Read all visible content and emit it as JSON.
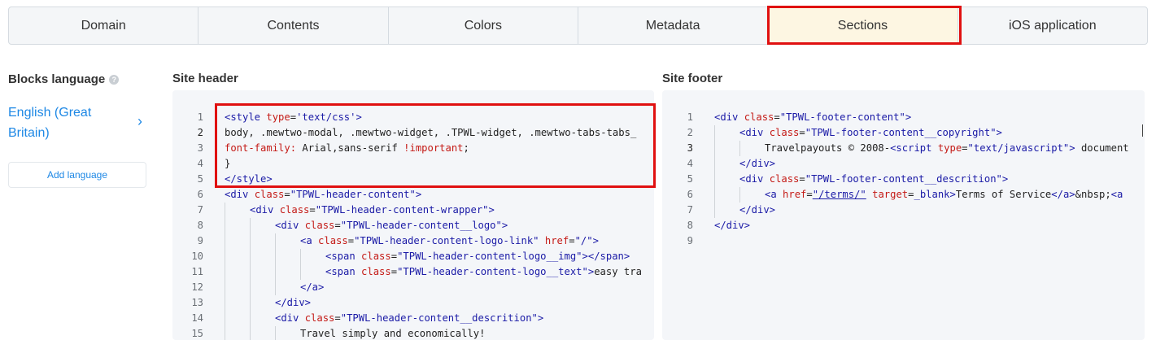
{
  "tabs": [
    {
      "label": "Domain"
    },
    {
      "label": "Contents"
    },
    {
      "label": "Colors"
    },
    {
      "label": "Metadata"
    },
    {
      "label": "Sections",
      "active": true
    },
    {
      "label": "iOS application"
    }
  ],
  "left": {
    "blocks_language_label": "Blocks language",
    "help_glyph": "?",
    "language": "English (Great Britain)",
    "add_language": "Add language"
  },
  "header_section": {
    "title": "Site header",
    "lines": [
      "<style type='text/css'>",
      "body, .mewtwo-modal, .mewtwo-widget, .TPWL-widget, .mewtwo-tabs-tabs_",
      "font-family: Arial,sans-serif !important;",
      "}",
      "</style>",
      "<div class=\"TPWL-header-content\">",
      "    <div class=\"TPWL-header-content-wrapper\">",
      "        <div class=\"TPWL-header-content__logo\">",
      "            <a class=\"TPWL-header-content-logo-link\" href=\"/\">",
      "                <span class=\"TPWL-header-content-logo__img\"></span>",
      "                <span class=\"TPWL-header-content-logo__text\">easy tra",
      "            </a>",
      "        </div>",
      "        <div class=\"TPWL-header-content__descrition\">",
      "            Travel simply and economically!"
    ]
  },
  "footer_section": {
    "title": "Site footer",
    "lines": [
      "<div class=\"TPWL-footer-content\">",
      "    <div class=\"TPWL-footer-content__copyright\">",
      "        Travelpayouts © 2008-<script type=\"text/javascript\"> document",
      "    </div>",
      "    <div class=\"TPWL-footer-content__descrition\">",
      "        <a href=\"/terms/\" target=_blank>Terms of Service</a>&nbsp;<a",
      "    </div>",
      "</div>",
      ""
    ]
  },
  "line_numbers": [
    "1",
    "2",
    "3",
    "4",
    "5",
    "6",
    "7",
    "8",
    "9",
    "10",
    "11",
    "12",
    "13",
    "14",
    "15"
  ]
}
